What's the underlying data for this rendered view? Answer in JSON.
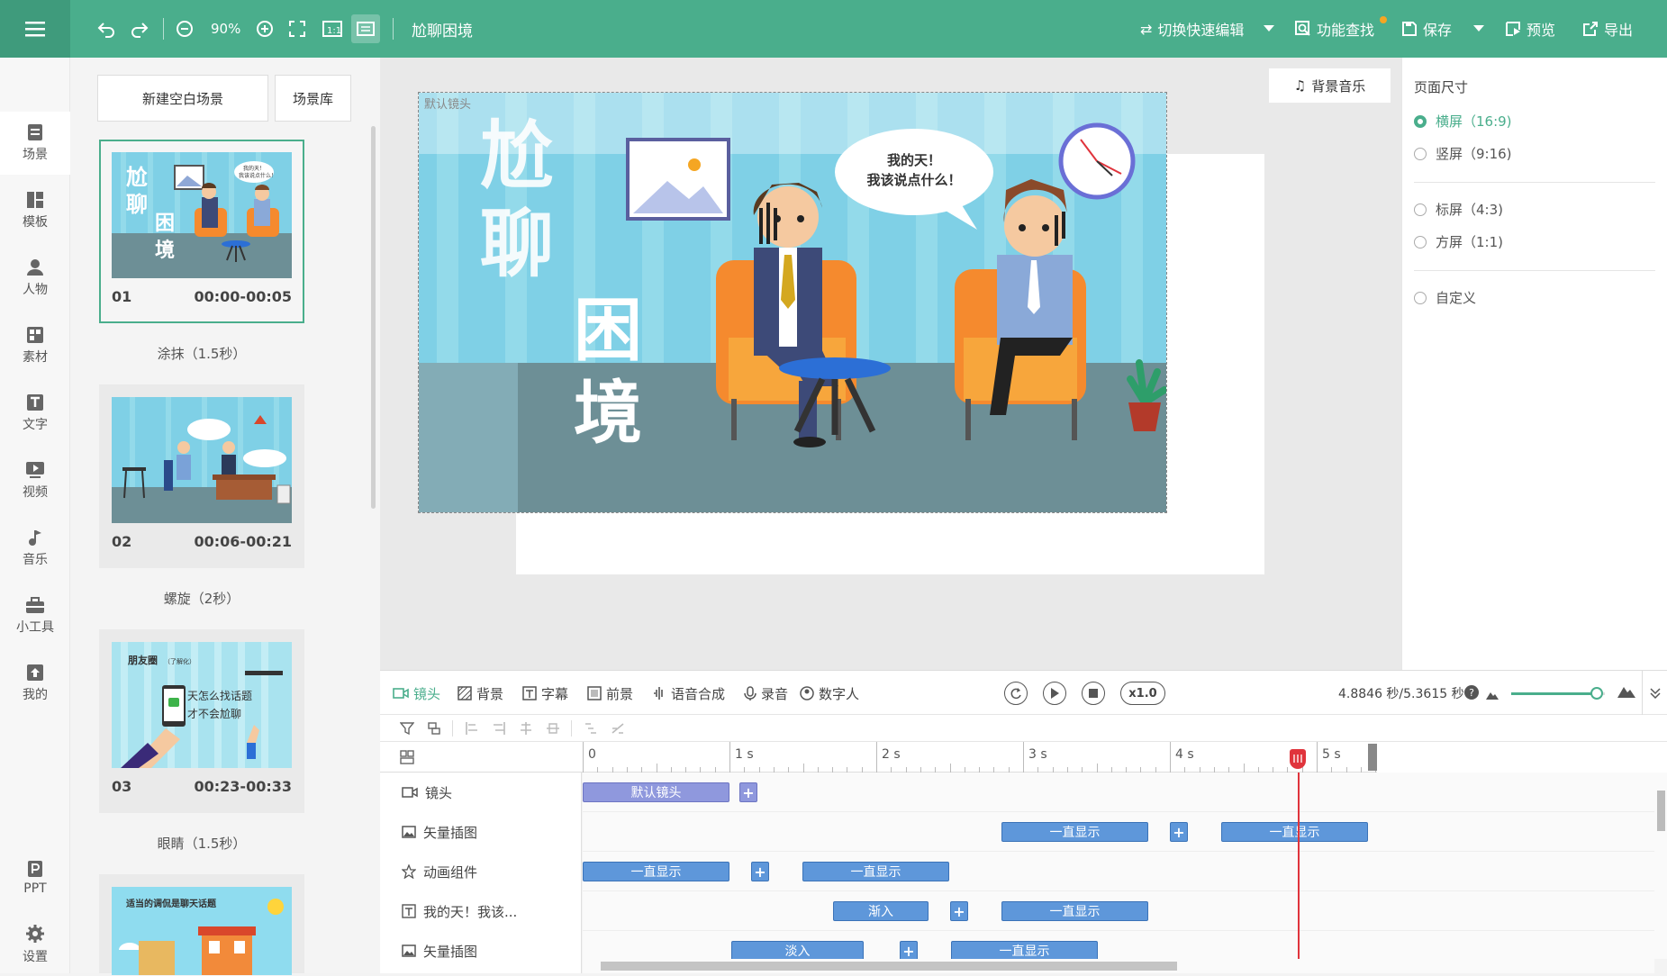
{
  "app": {
    "title": "尬聊困境",
    "zoom": "90%"
  },
  "topbar": {
    "switch_label": "切换快速编辑",
    "find_label": "功能查找",
    "save_label": "保存",
    "preview_label": "预览",
    "export_label": "导出"
  },
  "sidebar": {
    "items": [
      {
        "label": "场景",
        "icon": "scene-icon"
      },
      {
        "label": "模板",
        "icon": "template-icon"
      },
      {
        "label": "人物",
        "icon": "person-icon"
      },
      {
        "label": "素材",
        "icon": "material-icon"
      },
      {
        "label": "文字",
        "icon": "text-icon"
      },
      {
        "label": "视频",
        "icon": "video-icon"
      },
      {
        "label": "音乐",
        "icon": "music-icon"
      },
      {
        "label": "小工具",
        "icon": "toolbox-icon"
      },
      {
        "label": "我的",
        "icon": "upload-icon"
      },
      {
        "label": "PPT",
        "icon": "ppt-icon"
      },
      {
        "label": "设置",
        "icon": "gear-icon"
      }
    ]
  },
  "scenes": {
    "new_blank": "新建空白场景",
    "library": "场景库",
    "list": [
      {
        "index": "01",
        "time": "00:00-00:05",
        "transition": "涂抹（1.5秒）"
      },
      {
        "index": "02",
        "time": "00:06-00:21",
        "transition": "螺旋（2秒）"
      },
      {
        "index": "03",
        "time": "00:23-00:33",
        "transition": "眼睛（1.5秒）"
      }
    ],
    "thumb1_title_chars": [
      "尬",
      "聊",
      "困",
      "境"
    ],
    "thumb1_bubble": "我的天！我该说点什么！",
    "thumb3_title": "朋友圈",
    "thumb3_sub": "（了解化）",
    "thumb3_line1": "天怎么找话题",
    "thumb3_line2": "才不会尬聊",
    "thumb4_title": "适当的调侃是聊天话题"
  },
  "canvas": {
    "camera_label": "默认镜头",
    "bg_music": "背景音乐",
    "title_chars": [
      "尬",
      "聊",
      "困",
      "境"
    ],
    "bubble_line1": "我的天！",
    "bubble_line2": "我该说点什么！"
  },
  "properties": {
    "title": "页面尺寸",
    "options": [
      {
        "label": "横屏（16:9)",
        "selected": true
      },
      {
        "label": "竖屏（9:16)",
        "selected": false
      },
      {
        "label": "标屏（4:3)",
        "selected": false
      },
      {
        "label": "方屏（1:1)",
        "selected": false
      },
      {
        "label": "自定义",
        "selected": false
      }
    ]
  },
  "timeline": {
    "tabs": [
      {
        "label": "镜头",
        "icon": "camera-icon"
      },
      {
        "label": "背景",
        "icon": "background-icon"
      },
      {
        "label": "字幕",
        "icon": "subtitle-icon"
      },
      {
        "label": "前景",
        "icon": "foreground-icon"
      },
      {
        "label": "语音合成",
        "icon": "voice-icon"
      },
      {
        "label": "录音",
        "icon": "mic-icon"
      },
      {
        "label": "数字人",
        "icon": "digital-human-icon"
      }
    ],
    "speed": "x1.0",
    "time_readout": "4.8846 秒/5.3615 秒",
    "progress": 0.91,
    "ruler_labels": [
      "0",
      "1 s",
      "2 s",
      "3 s",
      "4 s",
      "5 s"
    ],
    "tracks": [
      {
        "label": "镜头",
        "icon": "camera-icon",
        "clips": [
          "默认镜头"
        ]
      },
      {
        "label": "矢量插图",
        "icon": "image-icon",
        "clips": [
          "一直显示",
          "一直显示"
        ]
      },
      {
        "label": "动画组件",
        "icon": "star-icon",
        "clips": [
          "一直显示",
          "一直显示"
        ]
      },
      {
        "label": "我的天！我该...",
        "icon": "text-icon",
        "clips": [
          "渐入",
          "一直显示"
        ]
      },
      {
        "label": "矢量插图",
        "icon": "image-icon",
        "clips": [
          "淡入",
          "一直显示"
        ]
      }
    ]
  },
  "colors": {
    "accent": "#4aae8c",
    "clip": "#5e97da",
    "camera_clip": "#8f98dd",
    "playhead": "#e0343c"
  }
}
